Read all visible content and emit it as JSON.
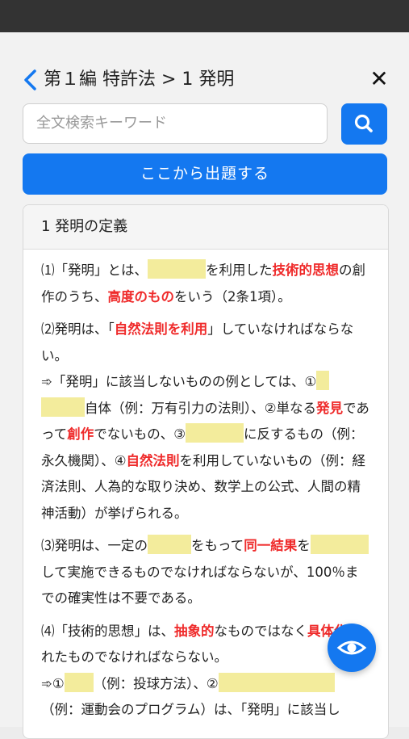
{
  "header": {
    "title": "第１編 特許法 > 1 発明"
  },
  "search": {
    "placeholder": "全文検索キーワード"
  },
  "cta_label": "ここから出題する",
  "section": {
    "heading": "1 発明の定義",
    "p1": {
      "a": "⑴「発明」とは、",
      "b": "を利用した",
      "c": "技術的思想",
      "d": "の創作のうち、",
      "e": "高度のもの",
      "f": "をいう（2条1項）。"
    },
    "p2": {
      "a": "⑵発明は、「",
      "b": "自然法則を利用",
      "c": "」していなければならない。"
    },
    "p3": {
      "a": "➾「発明」に該当しないものの例としては、①",
      "b": "自体（例：万有引力の法則）、②単なる",
      "c": "発見",
      "d": "であって",
      "e": "創作",
      "f": "でないもの、③",
      "g": "に反するもの（例：永久機関）、④",
      "h": "自然法則",
      "i": "を利用していないもの（例：経済法則、人為的な取り決め、数学上の公式、人間の精神活動）が挙げられる。"
    },
    "p4": {
      "a": "⑶発明は、一定の",
      "b": "をもって",
      "c": "同一結果",
      "d": "を",
      "e": "して実施できるものでなければならないが、100％までの確実性は不要である。"
    },
    "p5": {
      "a": "⑷「技術的思想」は、",
      "b": "抽象的",
      "c": "なものではなく",
      "d": "具体化",
      "e": "されたものでなければならない。"
    },
    "p6": {
      "a": "➾①",
      "b": "（例：投球方法）、②",
      "c": "（例：運動会のプログラム）は、「発明」に該当し"
    }
  },
  "icons": {
    "back": "chevron-left-icon",
    "close": "close-icon",
    "search": "search-icon",
    "eye": "eye-icon"
  },
  "colors": {
    "accent": "#1478f0",
    "emphasis": "#ef2b2b",
    "blank": "#f3ec9c"
  }
}
